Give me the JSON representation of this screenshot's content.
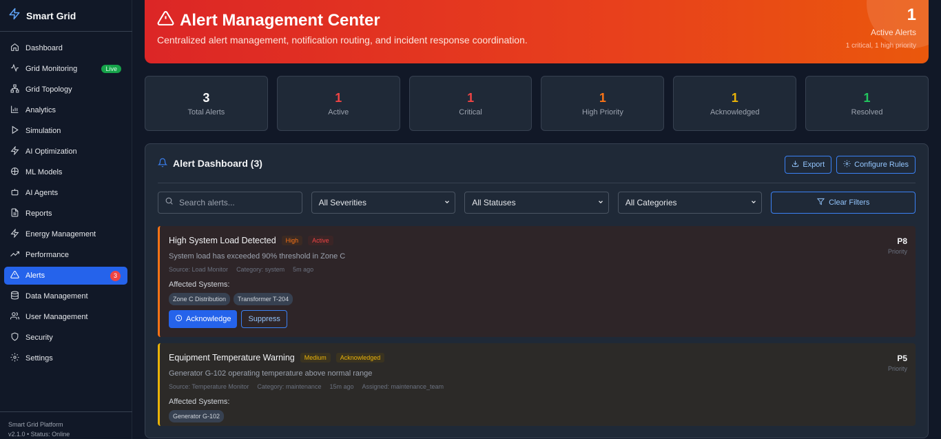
{
  "brand": {
    "name": "Smart Grid",
    "icon": "zap-icon",
    "accent": "#60a5fa"
  },
  "sidebar": {
    "items": [
      {
        "label": "Dashboard",
        "icon": "home-icon"
      },
      {
        "label": "Grid Monitoring",
        "icon": "activity-icon",
        "badge": "Live"
      },
      {
        "label": "Grid Topology",
        "icon": "network-icon"
      },
      {
        "label": "Analytics",
        "icon": "bar-chart-icon"
      },
      {
        "label": "Simulation",
        "icon": "play-icon"
      },
      {
        "label": "AI Optimization",
        "icon": "zap-icon"
      },
      {
        "label": "ML Models",
        "icon": "brain-icon"
      },
      {
        "label": "AI Agents",
        "icon": "bot-icon"
      },
      {
        "label": "Reports",
        "icon": "file-text-icon"
      },
      {
        "label": "Energy Management",
        "icon": "zap-icon"
      },
      {
        "label": "Performance",
        "icon": "trending-up-icon"
      },
      {
        "label": "Alerts",
        "icon": "alert-triangle-icon",
        "badge": "3",
        "active": true
      },
      {
        "label": "Data Management",
        "icon": "database-icon"
      },
      {
        "label": "User Management",
        "icon": "users-icon"
      },
      {
        "label": "Security",
        "icon": "shield-icon"
      },
      {
        "label": "Settings",
        "icon": "gear-icon"
      }
    ],
    "footer": {
      "line1": "Smart Grid Platform",
      "line2": "v2.1.0 • Status: Online"
    }
  },
  "hero": {
    "title": "Alert Management Center",
    "subtitle": "Centralized alert management, notification routing, and incident response coordination.",
    "count": "1",
    "count_label": "Active Alerts",
    "count_sub": "1 critical, 1 high priority"
  },
  "stats": [
    {
      "value": "3",
      "label": "Total Alerts",
      "color": "#f9fafb"
    },
    {
      "value": "1",
      "label": "Active",
      "color": "#ef4444"
    },
    {
      "value": "1",
      "label": "Critical",
      "color": "#ef4444"
    },
    {
      "value": "1",
      "label": "High Priority",
      "color": "#f97316"
    },
    {
      "value": "1",
      "label": "Acknowledged",
      "color": "#eab308"
    },
    {
      "value": "1",
      "label": "Resolved",
      "color": "#22c55e"
    }
  ],
  "panel": {
    "title": "Alert Dashboard (3)",
    "export_label": "Export",
    "configure_label": "Configure Rules"
  },
  "filters": {
    "search_placeholder": "Search alerts...",
    "severity": "All Severities",
    "status": "All Statuses",
    "category": "All Categories",
    "clear_label": "Clear Filters"
  },
  "alerts": [
    {
      "title": "High System Load Detected",
      "severity": "High",
      "status": "Active",
      "description": "System load has exceeded 90% threshold in Zone C",
      "source": "Source: Load Monitor",
      "category": "Category: system",
      "time": "5m ago",
      "affected_label": "Affected Systems:",
      "systems": [
        "Zone C Distribution",
        "Transformer T-204"
      ],
      "acknowledge_label": "Acknowledge",
      "suppress_label": "Suppress",
      "priority": "P8",
      "priority_label": "Priority"
    },
    {
      "title": "Equipment Temperature Warning",
      "severity": "Medium",
      "status": "Acknowledged",
      "description": "Generator G-102 operating temperature above normal range",
      "source": "Source: Temperature Monitor",
      "category": "Category: maintenance",
      "time": "15m ago",
      "assigned": "Assigned: maintenance_team",
      "affected_label": "Affected Systems:",
      "systems": [
        "Generator G-102"
      ],
      "priority": "P5",
      "priority_label": "Priority"
    }
  ]
}
